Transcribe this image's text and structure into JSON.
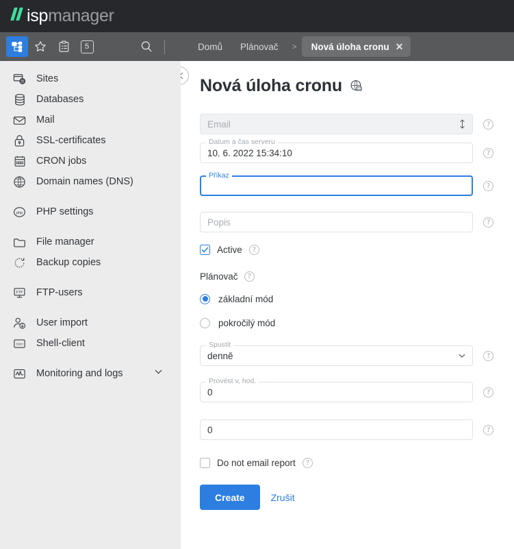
{
  "brand": {
    "logo_isp": "isp",
    "logo_manager": "manager",
    "accent_green": "#3ddc9b",
    "accent_blue": "#2c7ee0",
    "topbar_color": "#26282c",
    "navbar_color": "#58595a",
    "sidebar_color": "#ececec"
  },
  "navbar": {
    "icons": [
      {
        "name": "site-tree-icon",
        "active": true
      },
      {
        "name": "star-icon",
        "active": false
      },
      {
        "name": "clipboard-icon",
        "active": false
      },
      {
        "name": "badge-count-icon",
        "active": false
      }
    ],
    "badge_count": "5",
    "search_icon": "search-icon"
  },
  "breadcrumb": {
    "home": "Domů",
    "scheduler": "Plánovač",
    "separator": ">",
    "active_tab": "Nová úloha cronu",
    "close_glyph": "✕"
  },
  "sidebar": {
    "items": [
      {
        "label": "Sites",
        "icon": "sites-icon",
        "gap_after": false
      },
      {
        "label": "Databases",
        "icon": "database-icon",
        "gap_after": false
      },
      {
        "label": "Mail",
        "icon": "mail-icon",
        "gap_after": false
      },
      {
        "label": "SSL-certificates",
        "icon": "lock-icon",
        "gap_after": false
      },
      {
        "label": "CRON jobs",
        "icon": "calendar-icon",
        "gap_after": false
      },
      {
        "label": "Domain names (DNS)",
        "icon": "globe-icon",
        "gap_after": true
      },
      {
        "label": "PHP settings",
        "icon": "php-icon",
        "gap_after": true
      },
      {
        "label": "File manager",
        "icon": "folder-icon",
        "gap_after": false
      },
      {
        "label": "Backup copies",
        "icon": "backup-icon",
        "gap_after": true
      },
      {
        "label": "FTP-users",
        "icon": "ftp-icon",
        "gap_after": true
      },
      {
        "label": "User import",
        "icon": "user-import-icon",
        "gap_after": false
      },
      {
        "label": "Shell-client",
        "icon": "ssh-icon",
        "gap_after": true
      },
      {
        "label": "Monitoring and logs",
        "icon": "monitoring-icon",
        "gap_after": false,
        "chevron": true
      }
    ]
  },
  "main": {
    "close_label": "✕",
    "title": "Nová úloha cronu",
    "title_icon": "globe-translate-icon",
    "help_glyph": "?",
    "fields": {
      "email": {
        "placeholder": "Email",
        "value": "",
        "disabled": true,
        "icon": "updown-arrow-icon"
      },
      "server_datetime": {
        "legend": "Datum a čas serveru",
        "value": "10. 6. 2022 15:34:10"
      },
      "command": {
        "legend": "Příkaz",
        "value": "",
        "focused": true
      },
      "description": {
        "placeholder": "Popis",
        "value": ""
      },
      "run": {
        "legend": "Spustit",
        "value": "denně",
        "icon": "chevron-down-icon"
      },
      "hour": {
        "legend": "Provést v, hod.",
        "value": "0"
      },
      "minute": {
        "legend": "",
        "value": "0"
      }
    },
    "active_checkbox": {
      "label": "Active",
      "checked": true
    },
    "scheduler_group": {
      "title": "Plánovač",
      "options": [
        {
          "label": "základní mód",
          "selected": true
        },
        {
          "label": "pokročilý mód",
          "selected": false
        }
      ]
    },
    "no_email_checkbox": {
      "label": "Do not email report",
      "checked": false
    },
    "buttons": {
      "create": "Create",
      "cancel": "Zrušit"
    }
  }
}
